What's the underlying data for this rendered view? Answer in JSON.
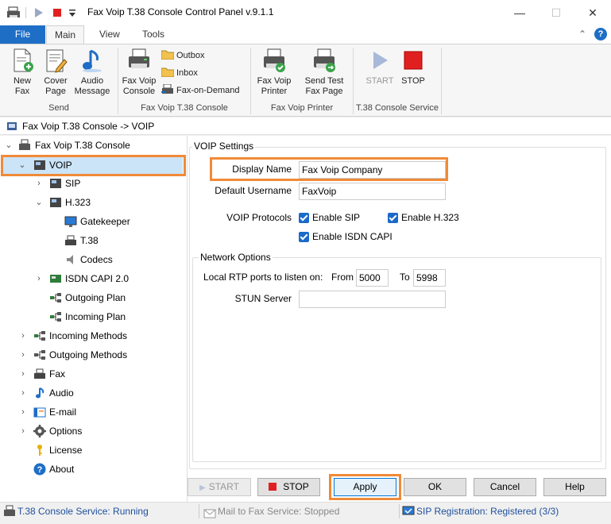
{
  "window": {
    "title": "Fax Voip T.38 Console Control Panel v.9.1.1",
    "minimize": "—",
    "maximize": "☐",
    "close": "✕"
  },
  "ribbon_tabs": [
    "File",
    "Main",
    "View",
    "Tools"
  ],
  "ribbon": {
    "send_group": {
      "label": "Send",
      "new_fax": "New\nFax",
      "cover_page": "Cover\nPage",
      "audio_message": "Audio\nMessage"
    },
    "console_group": {
      "label": "Fax Voip T.38 Console",
      "console": "Fax Voip\nConsole",
      "outbox": "Outbox",
      "inbox": "Inbox",
      "fax_on_demand": "Fax-on-Demand"
    },
    "printer_group": {
      "label": "Fax Voip Printer",
      "printer": "Fax Voip\nPrinter",
      "send_test": "Send Test\nFax Page"
    },
    "service_group": {
      "label": "T.38 Console Service",
      "start": "START",
      "stop": "STOP"
    }
  },
  "address": "Fax Voip T.38 Console -> VOIP",
  "tree": {
    "root": "Fax Voip T.38 Console",
    "voip": "VOIP",
    "sip": "SIP",
    "h323": "H.323",
    "gatekeeper": "Gatekeeper",
    "t38": "T.38",
    "codecs": "Codecs",
    "isdn": "ISDN CAPI 2.0",
    "outgoing_plan": "Outgoing Plan",
    "incoming_plan": "Incoming Plan",
    "incoming_methods": "Incoming Methods",
    "outgoing_methods": "Outgoing Methods",
    "fax": "Fax",
    "audio": "Audio",
    "email": "E-mail",
    "options": "Options",
    "license": "License",
    "about": "About"
  },
  "voip_settings": {
    "legend": "VOIP Settings",
    "display_name_label": "Display Name",
    "display_name_value": "Fax Voip Company",
    "default_username_label": "Default Username",
    "default_username_value": "FaxVoip",
    "protocols_label": "VOIP Protocols",
    "enable_sip": "Enable SIP",
    "enable_h323": "Enable H.323",
    "enable_isdn": "Enable ISDN CAPI"
  },
  "network_options": {
    "legend": "Network Options",
    "rtp_label": "Local RTP ports to listen on:",
    "from_label": "From",
    "from_value": "5000",
    "to_label": "To",
    "to_value": "5998",
    "stun_label": "STUN Server",
    "stun_value": ""
  },
  "buttons": {
    "start": "START",
    "stop": "STOP",
    "apply": "Apply",
    "ok": "OK",
    "cancel": "Cancel",
    "help": "Help"
  },
  "status": {
    "console_service": "T.38 Console Service: Running",
    "mail_service": "Mail to Fax Service: Stopped",
    "sip_registration": "SIP Registration: Registered (3/3)"
  },
  "colors": {
    "accent": "#1e6ec6",
    "highlight": "#f08a38",
    "stop_red": "#e02020"
  }
}
